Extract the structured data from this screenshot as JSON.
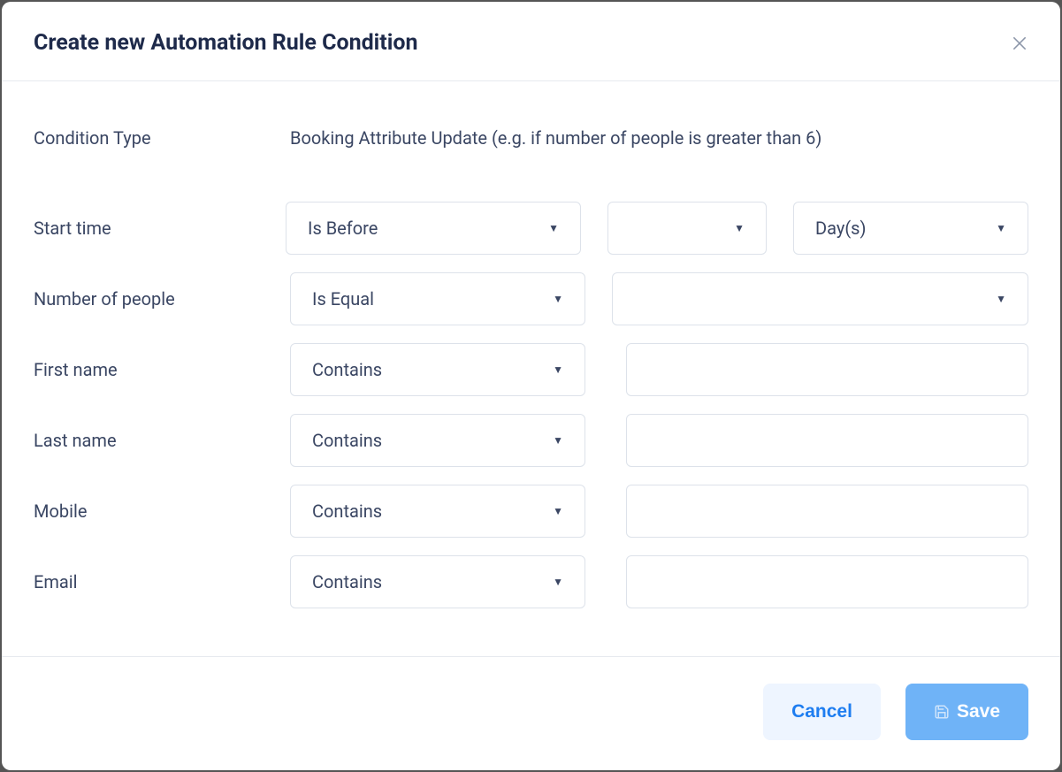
{
  "header": {
    "title": "Create new Automation Rule Condition"
  },
  "conditionType": {
    "label": "Condition Type",
    "value": "Booking Attribute Update (e.g. if number of people is greater than 6)"
  },
  "startTime": {
    "label": "Start time",
    "operator": "Is Before",
    "amount": "",
    "unit": "Day(s)"
  },
  "numberOfPeople": {
    "label": "Number of people",
    "operator": "Is Equal",
    "value": ""
  },
  "firstName": {
    "label": "First name",
    "operator": "Contains",
    "value": ""
  },
  "lastName": {
    "label": "Last name",
    "operator": "Contains",
    "value": ""
  },
  "mobile": {
    "label": "Mobile",
    "operator": "Contains",
    "value": ""
  },
  "email": {
    "label": "Email",
    "operator": "Contains",
    "value": ""
  },
  "footer": {
    "cancel": "Cancel",
    "save": "Save"
  }
}
